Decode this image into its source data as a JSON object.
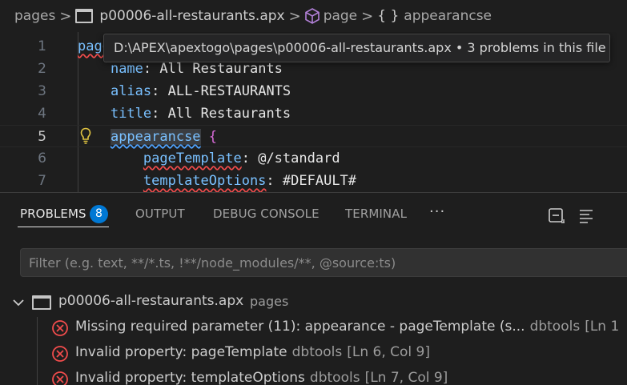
{
  "breadcrumb": {
    "folder": "pages",
    "file": "p00006-all-restaurants.apx",
    "symbol1": "page",
    "symbol2_braces": "{ }",
    "symbol2": "appearancse"
  },
  "editor": {
    "lines": [
      {
        "num": "1",
        "key": "page",
        "value": ""
      },
      {
        "num": "2",
        "key": "name",
        "value": "All Restaurants"
      },
      {
        "num": "3",
        "key": "alias",
        "value": "ALL-RESTAURANTS"
      },
      {
        "num": "4",
        "key": "title",
        "value": "All Restaurants"
      },
      {
        "num": "5",
        "key": "appearancse",
        "value": "{"
      },
      {
        "num": "6",
        "key": "pageTemplate",
        "value": "@/standard"
      },
      {
        "num": "7",
        "key": "templateOptions",
        "value": "#DEFAULT#"
      }
    ],
    "tooltip": "D:\\APEX\\apextogo\\pages\\p00006-all-restaurants.apx • 3 problems in this file"
  },
  "panel": {
    "tabs": {
      "problems": "PROBLEMS",
      "problems_count": "8",
      "output": "OUTPUT",
      "debug_console": "DEBUG CONSOLE",
      "terminal": "TERMINAL",
      "more": "···"
    },
    "filter_placeholder": "Filter (e.g. text, **/*.ts, !**/node_modules/**, @source:ts)",
    "file_group": {
      "name": "p00006-all-restaurants.apx",
      "folder": "pages"
    },
    "problems": [
      {
        "message": "Missing required parameter (11): appearance - pageTemplate (s...",
        "source": "dbtools",
        "location": "[Ln 1"
      },
      {
        "message": "Invalid property: pageTemplate",
        "source": "dbtools",
        "location": "[Ln 6, Col 9]"
      },
      {
        "message": "Invalid property: templateOptions",
        "source": "dbtools",
        "location": "[Ln 7, Col 9]"
      }
    ]
  },
  "colors": {
    "accent": "#0078d4",
    "error": "#f14c4c",
    "key": "#79c0ff",
    "bracket": "#d86bd8",
    "lightbulb": "#e2c541"
  }
}
